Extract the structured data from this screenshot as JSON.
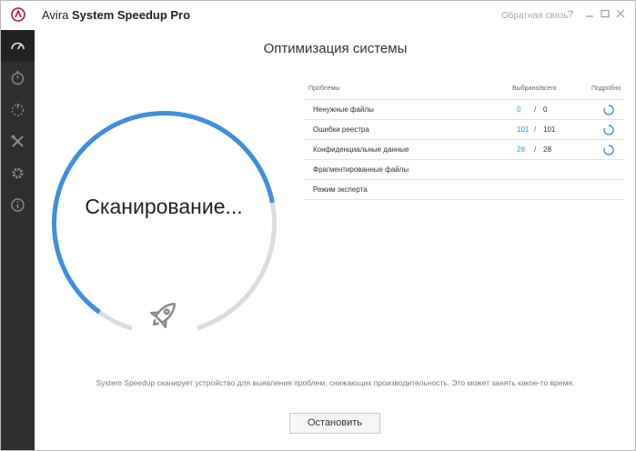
{
  "app": {
    "title_prefix": "Avira",
    "title_bold": "System Speedup Pro",
    "feedback": "Обратная связь",
    "help": "?",
    "accent": "#3d8fe0",
    "logo_color": "#c8102e"
  },
  "sidebar": {
    "icons": [
      "speedometer-icon",
      "stopwatch-icon",
      "power-icon",
      "tools-icon",
      "gear-icon",
      "info-icon"
    ]
  },
  "main": {
    "title": "Оптимизация системы",
    "scan_status": "Сканирование...",
    "progress": 0.62,
    "description": "System Speedup сканирует устройство для выявления проблем, снижающих производительность. Это может занять какое-то время.",
    "stop_label": "Остановить"
  },
  "table": {
    "headers": {
      "problems": "Проблемы",
      "selected_total": "Выбрано/всего",
      "details": "Подробно"
    },
    "rows": [
      {
        "name": "Ненужные файлы",
        "selected": "0",
        "total": "0",
        "loading": true
      },
      {
        "name": "Ошибки реестра",
        "selected": "101",
        "total": "101",
        "loading": true
      },
      {
        "name": "Конфиденциальные данные",
        "selected": "28",
        "total": "28",
        "loading": true
      },
      {
        "name": "Фрагментированные файлы",
        "selected": "",
        "total": "",
        "loading": false
      },
      {
        "name": "Режим эксперта",
        "selected": "",
        "total": "",
        "loading": false
      }
    ]
  }
}
